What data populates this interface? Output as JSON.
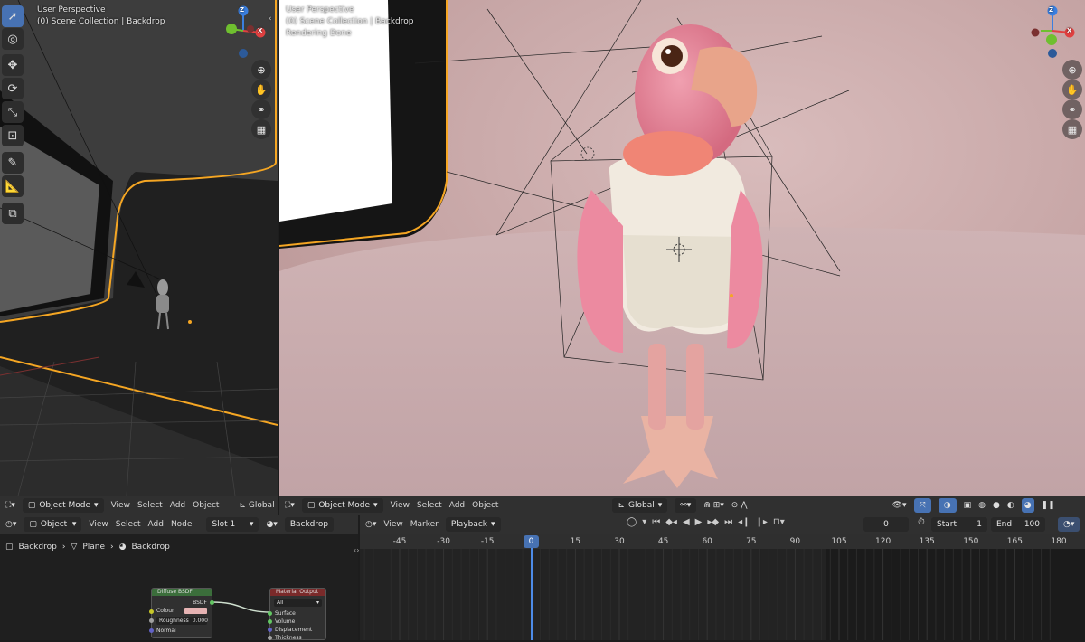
{
  "left_viewport": {
    "view_name": "User Perspective",
    "collection": "(0) Scene Collection | Backdrop",
    "gizmo": {
      "z": "Z",
      "x": "X"
    },
    "header": {
      "mode": "Object Mode",
      "menus": [
        "View",
        "Select",
        "Add",
        "Object"
      ],
      "orientation": "Global"
    }
  },
  "right_viewport": {
    "view_name": "User Perspective",
    "collection": "(0) Scene Collection | Backdrop",
    "status": "Rendering Done",
    "gizmo": {
      "z": "Z",
      "x": "X"
    },
    "header": {
      "mode": "Object Mode",
      "menus": [
        "View",
        "Select",
        "Add",
        "Object"
      ],
      "orientation": "Global"
    }
  },
  "node_editor": {
    "header": {
      "type": "Object",
      "menus": [
        "View",
        "Select",
        "Add",
        "Node"
      ],
      "slot": "Slot 1",
      "material": "Backdrop"
    },
    "breadcrumb": [
      "Backdrop",
      "Plane",
      "Backdrop"
    ],
    "nodes": {
      "diffuse": {
        "title": "Diffuse BSDF",
        "output": "BSDF",
        "colour_label": "Colour",
        "roughness_label": "Roughness",
        "roughness_value": "0.000",
        "normal_label": "Normal",
        "header_color": "#3b6e3b"
      },
      "output": {
        "title": "Material Output",
        "target": "All",
        "inputs": [
          "Surface",
          "Volume",
          "Displacement",
          "Thickness"
        ],
        "header_color": "#7a2a2a"
      }
    }
  },
  "timeline": {
    "menus": [
      "View",
      "Marker",
      "Playback"
    ],
    "current_frame": "0",
    "start_label": "Start",
    "start_value": "1",
    "end_label": "End",
    "end_value": "100",
    "ticks": [
      "-45",
      "-30",
      "-15",
      "0",
      "15",
      "30",
      "45",
      "60",
      "75",
      "90",
      "105",
      "120",
      "135",
      "150",
      "165",
      "180"
    ],
    "playhead_label": "0"
  },
  "colors": {
    "accent": "#4772b3",
    "selection_outline": "#f5a623",
    "axis_x": "#e04040",
    "axis_y": "#6fbf2f",
    "axis_z": "#3a7fe0"
  }
}
